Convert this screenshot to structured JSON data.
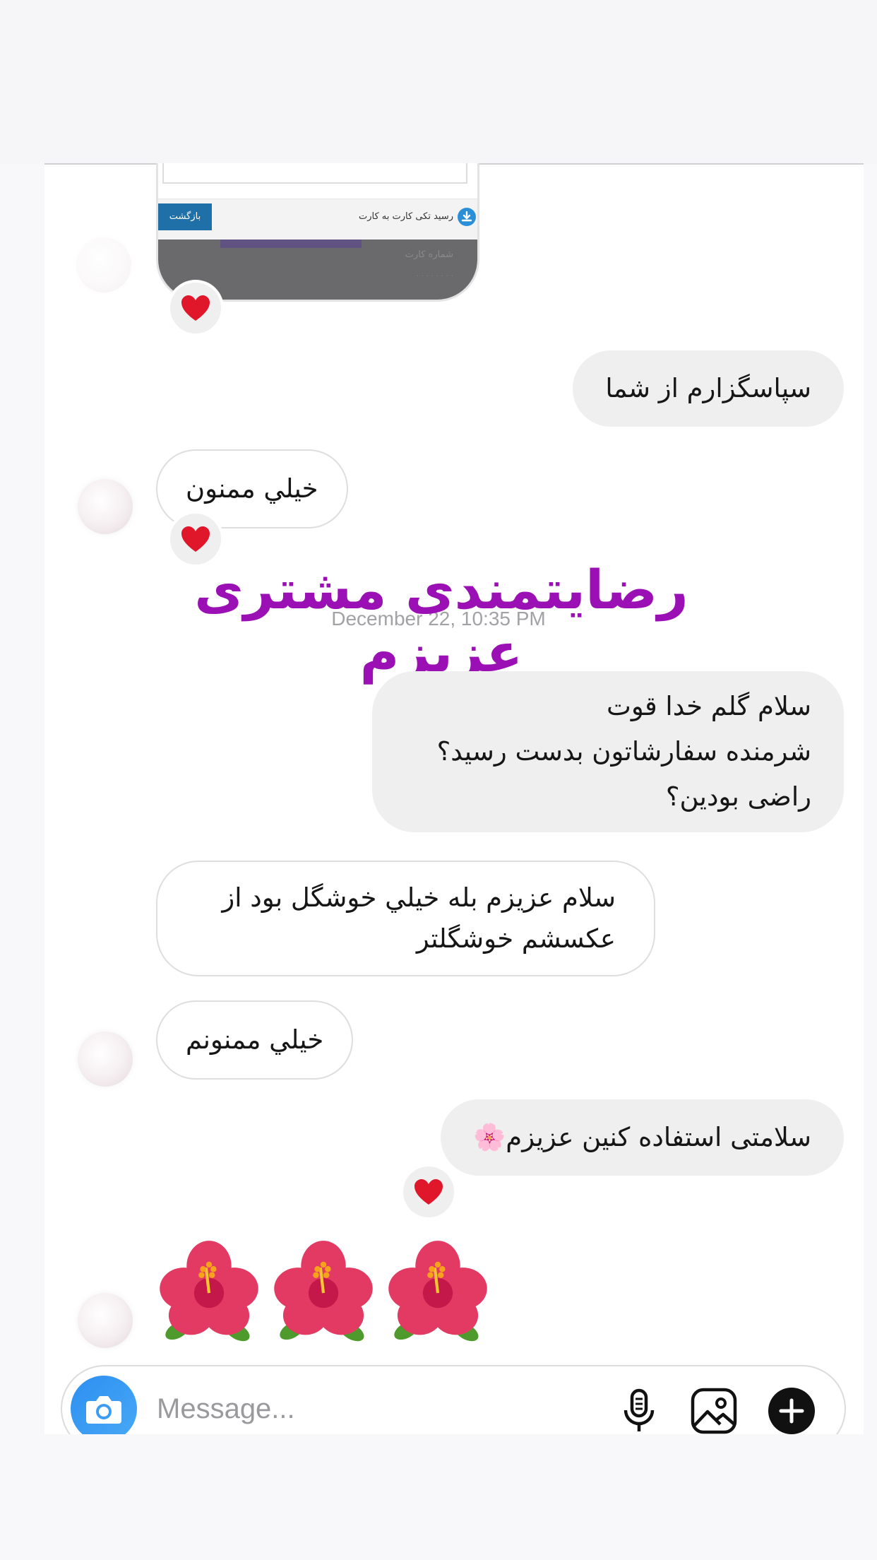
{
  "shared_image": {
    "back_label": "بازگشت",
    "receipt_label": "رسید تکی کارت به کارت"
  },
  "messages": [
    {
      "id": "m1",
      "direction": "out",
      "text": "سپاسگزارم از شما"
    },
    {
      "id": "m2",
      "direction": "in",
      "text": "خيلي ممنون",
      "reaction": "heart"
    },
    {
      "id": "m3",
      "direction": "out",
      "text": "سلام گلم خدا قوت\nشرمنده سفارشاتون بدست رسيد؟\nراضی بودين؟"
    },
    {
      "id": "m4",
      "direction": "in",
      "text": "سلام عزيزم بله خيلي خوشگل بود از\nعکسشم خوشگلتر"
    },
    {
      "id": "m5",
      "direction": "in",
      "text": "خيلي ممنونم"
    },
    {
      "id": "m6",
      "direction": "out",
      "text": "سلامتی استفاده کنين عزيزم🌸",
      "reaction": "heart"
    },
    {
      "id": "m7",
      "direction": "in",
      "emoji": [
        "hibiscus",
        "hibiscus",
        "hibiscus"
      ]
    }
  ],
  "timestamp": "December 22, 10:35 PM",
  "overlay_title": "رضايتمندی مشتری عزيزم",
  "composer": {
    "placeholder": "Message...",
    "icons": [
      "camera-icon",
      "microphone-icon",
      "gallery-icon",
      "plus-icon"
    ]
  },
  "colors": {
    "overlay": "#9a10b4",
    "camera_button": "#3a9cf3",
    "reaction": "#e0162b"
  }
}
